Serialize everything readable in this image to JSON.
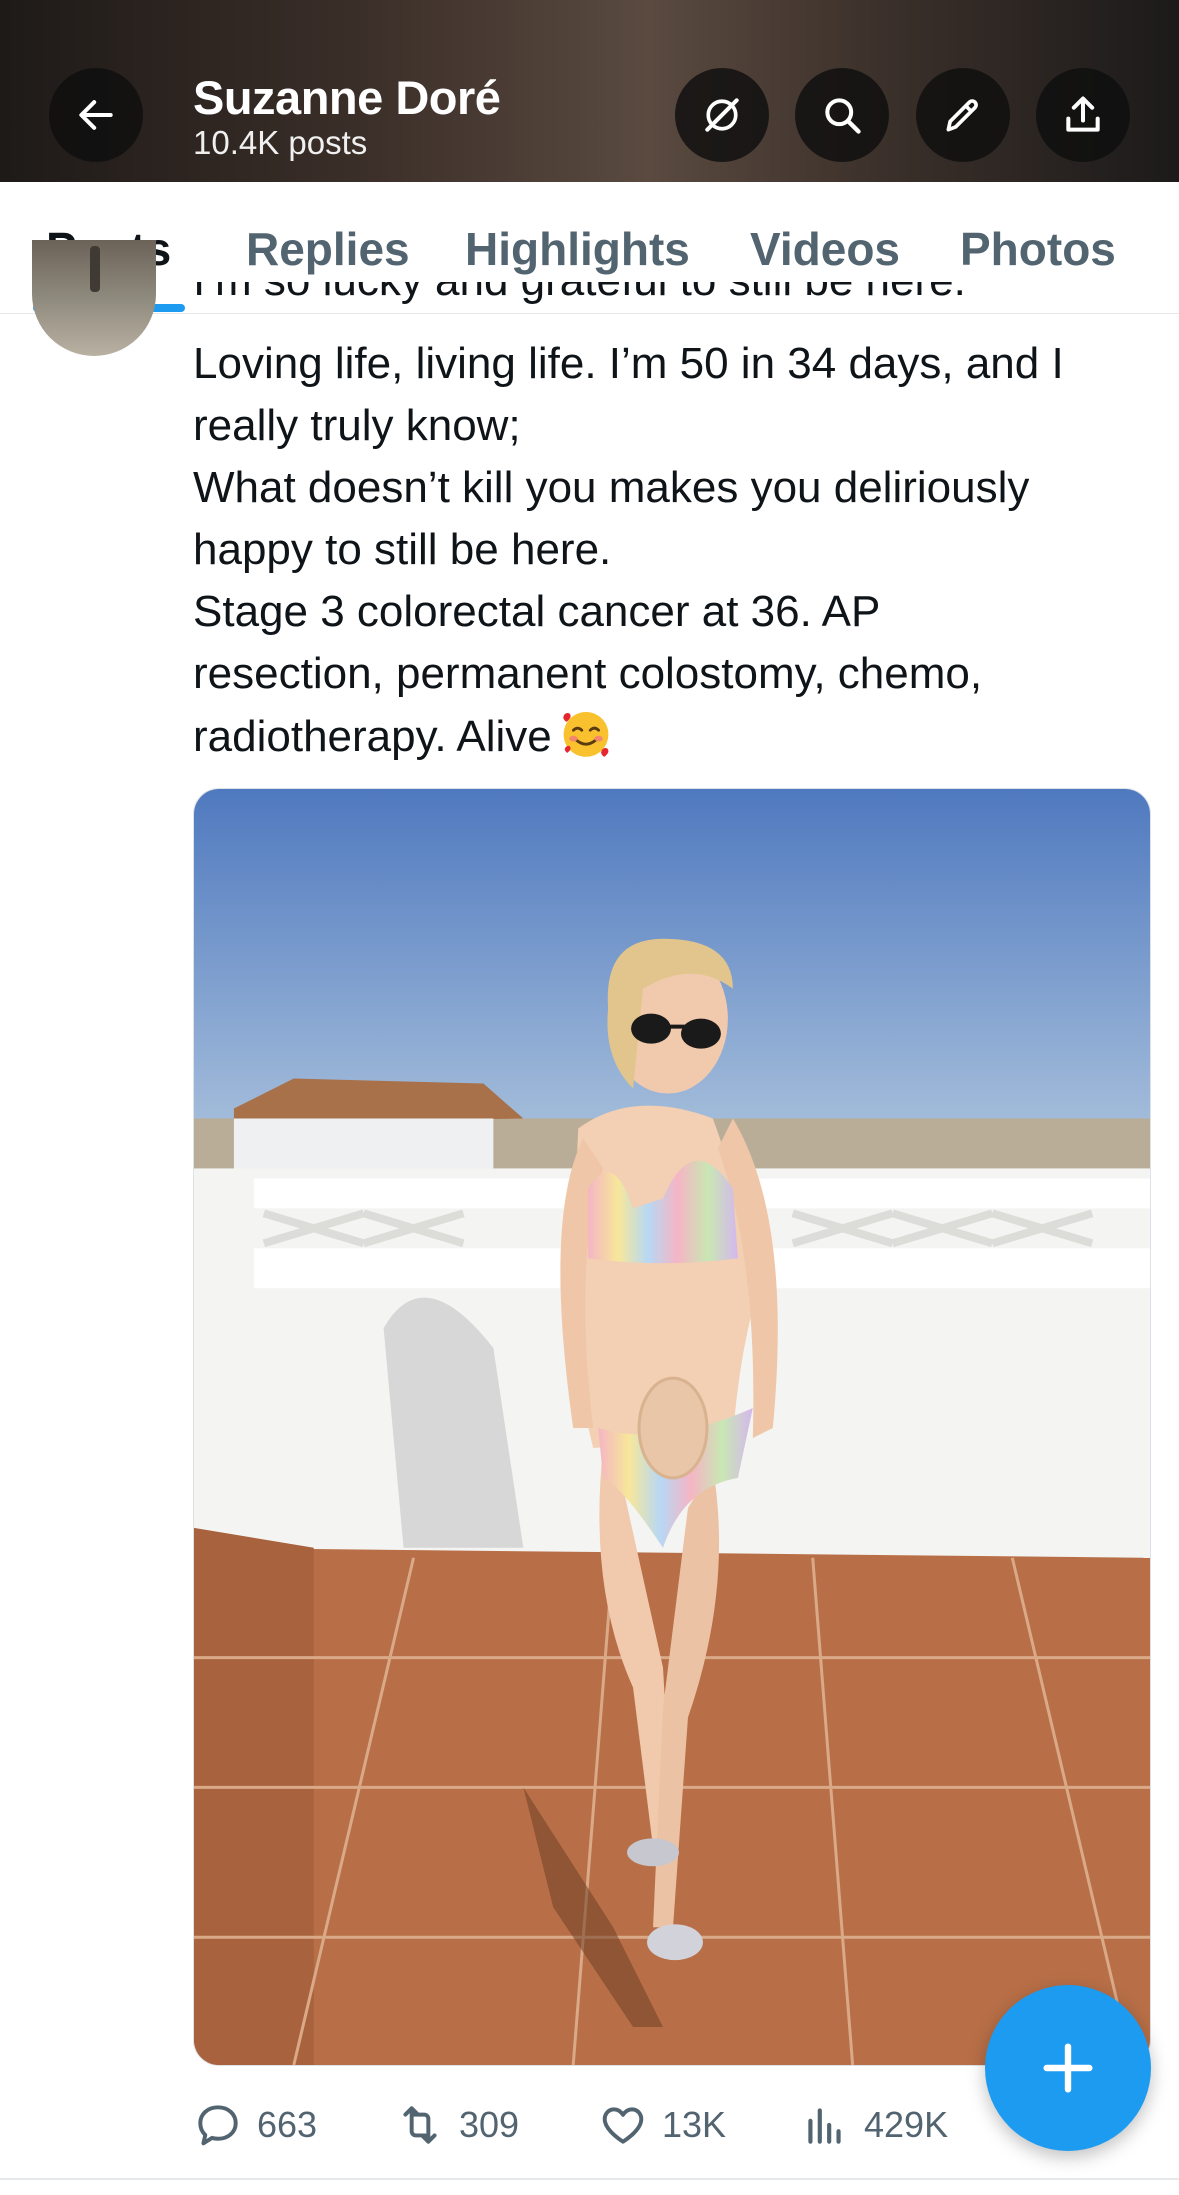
{
  "header": {
    "name": "Suzanne Doré",
    "post_count": "10.4K posts",
    "icons": [
      "back-arrow-icon",
      "grok-icon",
      "search-icon",
      "edit-icon",
      "share-icon"
    ]
  },
  "tabs": [
    {
      "label": "Posts",
      "active": true
    },
    {
      "label": "Replies",
      "active": false
    },
    {
      "label": "Highlights",
      "active": false
    },
    {
      "label": "Videos",
      "active": false
    },
    {
      "label": "Photos",
      "active": false
    }
  ],
  "tweet": {
    "cut_line": "I’m so lucky and grateful to still be here.",
    "lines": [
      "Loving life, living life. I’m 50 in 34 days, and I",
      "really truly know;",
      "What doesn’t kill you makes you deliriously",
      "happy to still be here.",
      "Stage 3 colorectal cancer at 36. AP",
      "resection, permanent colostomy, chemo,",
      "radiotherapy. Alive"
    ],
    "emoji": "smiling-face-with-hearts"
  },
  "actions": {
    "replies": "663",
    "reposts": "309",
    "likes": "13K",
    "views": "429K"
  },
  "colors": {
    "accent": "#1d9bf0",
    "text": "#0f1419",
    "muted": "#536471"
  }
}
